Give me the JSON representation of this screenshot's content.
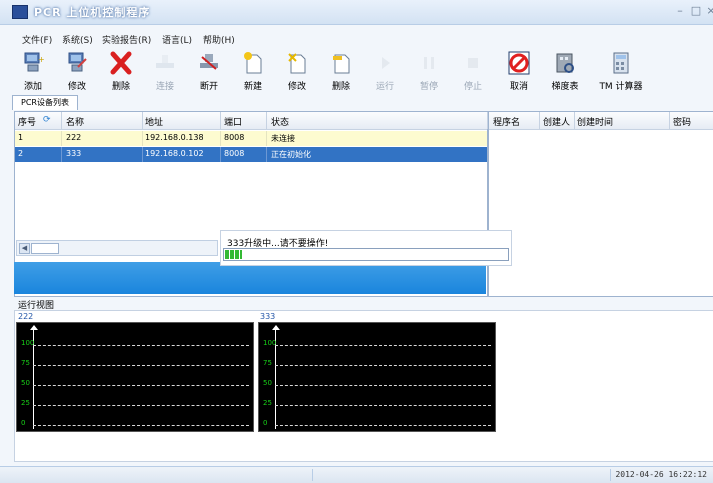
{
  "window": {
    "title": "PCR 上位机控制程序",
    "min_glyph": "–",
    "max_glyph": "□",
    "close_glyph": "×"
  },
  "menu": [
    "文件(F)",
    "系统(S)",
    "实验报告(R)",
    "语言(L)",
    "帮助(H)"
  ],
  "toolbar": [
    {
      "label": "添加",
      "icon": "add-device-icon",
      "enabled": true
    },
    {
      "label": "修改",
      "icon": "edit-device-icon",
      "enabled": true
    },
    {
      "label": "删除",
      "icon": "delete-x-icon",
      "enabled": true
    },
    {
      "label": "连接",
      "icon": "connect-icon",
      "enabled": false
    },
    {
      "label": "断开",
      "icon": "disconnect-icon",
      "enabled": true
    },
    {
      "label": "新建",
      "icon": "new-file-icon",
      "enabled": true
    },
    {
      "label": "修改",
      "icon": "edit-file-icon",
      "enabled": true
    },
    {
      "label": "删除",
      "icon": "delete-file-icon",
      "enabled": true
    },
    {
      "label": "运行",
      "icon": "run-icon",
      "enabled": false
    },
    {
      "label": "暂停",
      "icon": "pause-icon",
      "enabled": false
    },
    {
      "label": "停止",
      "icon": "stop-icon",
      "enabled": false
    },
    {
      "label": "取消",
      "icon": "cancel-icon",
      "enabled": true
    },
    {
      "label": "梯度表",
      "icon": "gradient-table-icon",
      "enabled": true
    },
    {
      "label": "TM 计算器",
      "icon": "calculator-icon",
      "enabled": true
    }
  ],
  "tab_label": "PCR设备列表",
  "device_table": {
    "columns": [
      "序号",
      "名称",
      "地址",
      "端口",
      "状态"
    ],
    "rows": [
      {
        "seq": "1",
        "name": "222",
        "address": "192.168.0.138",
        "port": "8008",
        "status": "未连接"
      },
      {
        "seq": "2",
        "name": "333",
        "address": "192.168.0.102",
        "port": "8008",
        "status": "正在初始化"
      }
    ]
  },
  "program_table": {
    "columns": [
      "程序名",
      "创建人",
      "创建时间",
      "密码"
    ]
  },
  "progress": {
    "message": "333升级中...请不要操作!",
    "fraction": 0.06
  },
  "run_view": {
    "title": "运行视图",
    "monitors": [
      {
        "name": "222",
        "ticks": [
          "100",
          "75",
          "50",
          "25",
          "0"
        ]
      },
      {
        "name": "333",
        "ticks": [
          "100",
          "75",
          "50",
          "25",
          "0"
        ]
      }
    ]
  },
  "status": {
    "datetime": "2012-04-26 16:22:12"
  },
  "colors": {
    "selected_row": "#3273c4",
    "unconnected_row": "#fdfbd0",
    "accent": "#1a85dd",
    "grid_text": "#18d018"
  }
}
